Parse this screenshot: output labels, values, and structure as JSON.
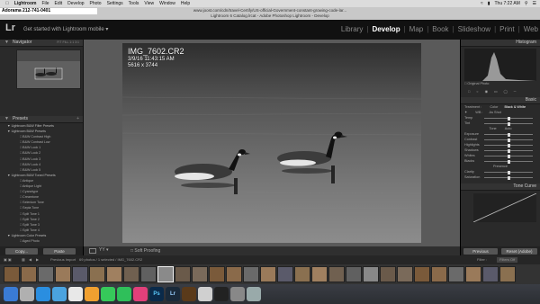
{
  "menubar": {
    "items": [
      "Lightroom",
      "File",
      "Edit",
      "Develop",
      "Photo",
      "Settings",
      "Tools",
      "View",
      "Window",
      "Help"
    ],
    "clock": "Thu 7:22 AM"
  },
  "titlebar": {
    "phone": "Adorama 212-741-0401",
    "url": "www.joost.com/cdn/travel-Certify/US-official-Government-constant-growing-code-lar...",
    "window_title": "Lightroom 6 Catalog.lrcat - Adobe Photoshop Lightroom - Develop"
  },
  "identity": {
    "logo": "Lr",
    "get_started": "Get started with Lightroom mobile",
    "modules": [
      "Library",
      "Develop",
      "Map",
      "Book",
      "Slideshow",
      "Print",
      "Web"
    ],
    "active_module": "Develop"
  },
  "left_panel": {
    "navigator": {
      "title": "Navigator",
      "zoom": "FIT  FILL  1:1  3:1"
    },
    "presets": {
      "title": "Presets",
      "rows": [
        {
          "kind": "folder",
          "label": "Lightroom B&W Filter Presets"
        },
        {
          "kind": "folder",
          "label": "Lightroom B&W Presets"
        },
        {
          "kind": "item",
          "label": "B&W Contrast High"
        },
        {
          "kind": "item",
          "label": "B&W Contrast Low"
        },
        {
          "kind": "item",
          "label": "B&W Look 1"
        },
        {
          "kind": "item",
          "label": "B&W Look 2"
        },
        {
          "kind": "item",
          "label": "B&W Look 3"
        },
        {
          "kind": "item",
          "label": "B&W Look 4"
        },
        {
          "kind": "item",
          "label": "B&W Look 5"
        },
        {
          "kind": "folder",
          "label": "Lightroom B&W Toned Presets"
        },
        {
          "kind": "item",
          "label": "Antique"
        },
        {
          "kind": "item",
          "label": "Antique Light"
        },
        {
          "kind": "item",
          "label": "Cyanotype"
        },
        {
          "kind": "item",
          "label": "Creamtone"
        },
        {
          "kind": "item",
          "label": "Selenium Tone"
        },
        {
          "kind": "item",
          "label": "Sepia Tone"
        },
        {
          "kind": "item",
          "label": "Split Tone 1"
        },
        {
          "kind": "item",
          "label": "Split Tone 2"
        },
        {
          "kind": "item",
          "label": "Split Tone 3"
        },
        {
          "kind": "item",
          "label": "Split Tone 4"
        },
        {
          "kind": "folder",
          "label": "Lightroom Color Presets"
        },
        {
          "kind": "item",
          "label": "Aged Photo"
        }
      ]
    },
    "copy_label": "Copy...",
    "paste_label": "Paste"
  },
  "photo": {
    "filename": "IMG_7602.CR2",
    "date": "3/9/16 11:43:15 AM",
    "dimensions": "5616 x 3744"
  },
  "toolbar": {
    "soft_proofing": "Soft Proofing"
  },
  "right_panel": {
    "histogram_title": "Histogram",
    "original_photo": "Original Photo",
    "basic_title": "Basic",
    "treatment_label": "Treatment :",
    "color_label": "Color",
    "bw_label": "Black & White",
    "wb_label": "WB :",
    "wb_value": "As Shot",
    "sliders": [
      "Temp",
      "Tint",
      "Exposure",
      "Contrast",
      "Highlights",
      "Shadows",
      "Whites",
      "Blacks",
      "Clarity",
      "Saturation"
    ],
    "tone_label": "Tone",
    "auto_label": "Auto",
    "presence_label": "Presence",
    "tone_curve_title": "Tone Curve",
    "previous_label": "Previous",
    "reset_label": "Reset (Adobe)"
  },
  "filmstrip": {
    "prev_import": "Previous Import",
    "count": "69 photos / 1 selected / IMG_7602.CR2",
    "filter_label": "Filter :",
    "filter_value": "Filters Off",
    "thumb_count": 30,
    "selected_index": 9
  },
  "dock": {
    "icons": [
      "finder-icon",
      "launchpad-icon",
      "safari-icon",
      "mail-icon",
      "calendar-icon",
      "photos-icon",
      "messages-icon",
      "facetime-icon",
      "music-icon",
      "photoshop-icon",
      "lightroom-icon",
      "bridge-icon",
      "preview-icon",
      "terminal-icon",
      "settings-icon",
      "trash-icon"
    ],
    "ps_text": "Ps",
    "lr_text": "Lr"
  },
  "colors": {
    "accent_active": "#ffffff",
    "panel_bg": "#2a2a2a",
    "center_bg": "#5a5a5a"
  }
}
